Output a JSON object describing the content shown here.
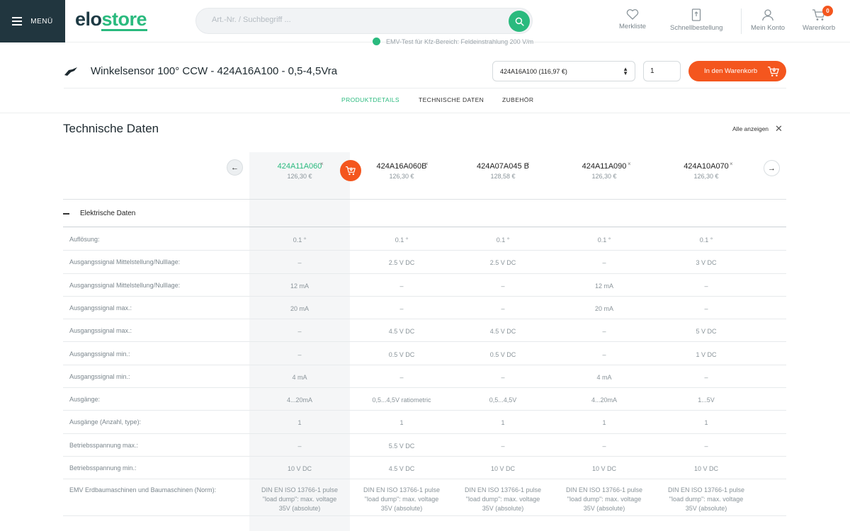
{
  "header": {
    "menu_label": "MENÜ",
    "logo_part1": "elo",
    "logo_part2": "store",
    "search_placeholder": "Art.-Nr. / Suchbegriff ...",
    "merkliste": "Merkliste",
    "schnellbestellung": "Schnellbestellung",
    "konto": "Mein Konto",
    "warenkorb": "Warenkorb",
    "cart_count": "0"
  },
  "notice": "EMV-Test für Kfz-Bereich: Feldeinstrahlung 200 V/m",
  "product": {
    "title": "Winkelsensor 100° CCW - 424A16A100 - 0,5-4,5Vra",
    "variant": "424A16A100 (116,97 €)",
    "quantity": "1",
    "add_to_cart": "In den Warenkorb"
  },
  "tabs": [
    "PRODUKTDETAILS",
    "TECHNISCHE DATEN",
    "ZUBEHÖR"
  ],
  "section": {
    "title": "Technische Daten",
    "show_all": "Alle anzeigen"
  },
  "compare_products": [
    {
      "code": "424A11A060",
      "price": "126,30 €"
    },
    {
      "code": "424A16A060B",
      "price": "126,30 €"
    },
    {
      "code": "424A07A045 B",
      "price": "128,58 €"
    },
    {
      "code": "424A11A090",
      "price": "126,30 €"
    },
    {
      "code": "424A10A070",
      "price": "126,30 €"
    }
  ],
  "group": "Elektrische Daten",
  "rows": [
    {
      "label": "Auflösung:",
      "values": [
        "0.1 °",
        "0.1 °",
        "0.1 °",
        "0.1 °",
        "0.1 °"
      ]
    },
    {
      "label": "Ausgangssignal Mittelstellung/Nulllage:",
      "values": [
        "–",
        "2.5 V DC",
        "2.5 V DC",
        "–",
        "3 V DC"
      ]
    },
    {
      "label": "Ausgangssignal Mittelstellung/Nulllage:",
      "values": [
        "12 mA",
        "–",
        "–",
        "12 mA",
        "–"
      ]
    },
    {
      "label": "Ausgangssignal max.:",
      "values": [
        "20 mA",
        "–",
        "–",
        "20 mA",
        "–"
      ]
    },
    {
      "label": "Ausgangssignal max.:",
      "values": [
        "–",
        "4.5 V DC",
        "4.5 V DC",
        "–",
        "5 V DC"
      ]
    },
    {
      "label": "Ausgangssignal min.:",
      "values": [
        "–",
        "0.5 V DC",
        "0.5 V DC",
        "–",
        "1 V DC"
      ]
    },
    {
      "label": "Ausgangssignal min.:",
      "values": [
        "4 mA",
        "–",
        "–",
        "4 mA",
        "–"
      ]
    },
    {
      "label": "Ausgänge:",
      "values": [
        "4...20mA",
        "0,5...4,5V ratiometric",
        "0,5...4,5V",
        "4...20mA",
        "1...5V"
      ]
    },
    {
      "label": "Ausgänge (Anzahl, type):",
      "values": [
        "1",
        "1",
        "1",
        "1",
        "1"
      ]
    },
    {
      "label": "Betriebsspannung max.:",
      "values": [
        "–",
        "5.5 V DC",
        "–",
        "–",
        "–"
      ]
    },
    {
      "label": "Betriebsspannung min.:",
      "values": [
        "10 V DC",
        "4.5 V DC",
        "10 V DC",
        "10 V DC",
        "10 V DC"
      ]
    },
    {
      "label": "EMV Erdbaumaschinen und Baumaschinen (Norm):",
      "values": [
        "DIN EN ISO 13766-1 pulse \"load dump\": max. voltage 35V (absolute)",
        "DIN EN ISO 13766-1 pulse \"load dump\": max. voltage 35V (absolute)",
        "DIN EN ISO 13766-1 pulse \"load dump\": max. voltage 35V (absolute)",
        "DIN EN ISO 13766-1 pulse \"load dump\": max. voltage 35V (absolute)",
        "DIN EN ISO 13766-1 pulse \"load dump\": max. voltage 35V (absolute)"
      ]
    }
  ],
  "colors": {
    "brand_green": "#2aba7e",
    "accent_orange": "#f4561e",
    "menu_dark": "#21363f"
  }
}
